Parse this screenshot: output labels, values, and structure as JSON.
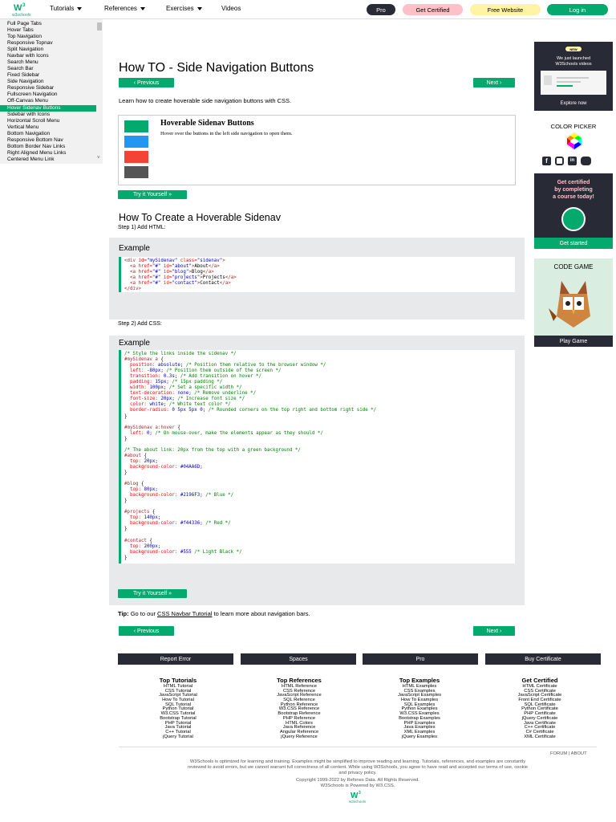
{
  "topnav": {
    "logo_text": "w3schools",
    "tutorials": "Tutorials",
    "references": "References",
    "exercises": "Exercises",
    "videos": "Videos",
    "pro": "Pro",
    "get_certified": "Get Certified",
    "free_website": "Free Website",
    "login": "Log in"
  },
  "sidebar": {
    "items": [
      "Full Page Tabs",
      "Hover Tabs",
      "Top Navigation",
      "Responsive Topnav",
      "Split Navigation",
      "Navbar with Icons",
      "Search Menu",
      "Search Bar",
      "Fixed Sidebar",
      "Side Navigation",
      "Responsive Sidebar",
      "Fullscreen Navigation",
      "Off-Canvas Menu",
      "Hover Sidenav Buttons",
      "Sidebar with Icons",
      "Horizontal Scroll Menu",
      "Vertical Menu",
      "Bottom Navigation",
      "Responsive Bottom Nav",
      "Bottom Border Nav Links",
      "Right Aligned Menu Links",
      "Centered Menu Link"
    ],
    "active_index": 13
  },
  "main": {
    "title": "How TO - Side Navigation Buttons",
    "previous": "Previous",
    "next": "Next",
    "intro": "Learn how to create hoverable side navigation buttons with CSS.",
    "demo_title": "Hoverable Sidenav Buttons",
    "demo_text": "Hover over the buttons in the left side navigation to open them.",
    "demo_colors": [
      "#04AA6D",
      "#2196F3",
      "#f44336",
      "#555555"
    ],
    "try_it": "Try it Yourself »",
    "h2": "How To Create a Hoverable Sidenav",
    "step1": "Step 1) Add HTML:",
    "step2": "Step 2) Add CSS:",
    "example_label": "Example",
    "tip_bold": "Tip:",
    "tip_before": " Go to our ",
    "tip_link": "CSS Navbar Tutorial",
    "tip_after": " to learn more about navigation bars."
  },
  "rightbar": {
    "ad1_badge": "NEW",
    "ad1_line1": "We just launched",
    "ad1_line2": "W3Schools videos",
    "ad1_cta": "Explore now",
    "color_picker": "COLOR PICKER",
    "ad2_line1": "Get certified",
    "ad2_line2": "by completing",
    "ad2_line3": "a course today!",
    "ad2_cta": "Get started",
    "code_game": "CODE GAME",
    "play_game": "Play Game"
  },
  "footer": {
    "buttons": [
      "Report Error",
      "Spaces",
      "Pro",
      "Buy Certificate"
    ],
    "columns": [
      {
        "title": "Top Tutorials",
        "items": [
          "HTML Tutorial",
          "CSS Tutorial",
          "JavaScript Tutorial",
          "How To Tutorial",
          "SQL Tutorial",
          "Python Tutorial",
          "W3.CSS Tutorial",
          "Bootstrap Tutorial",
          "PHP Tutorial",
          "Java Tutorial",
          "C++ Tutorial",
          "jQuery Tutorial"
        ]
      },
      {
        "title": "Top References",
        "items": [
          "HTML Reference",
          "CSS Reference",
          "JavaScript Reference",
          "SQL Reference",
          "Python Reference",
          "W3.CSS Reference",
          "Bootstrap Reference",
          "PHP Reference",
          "HTML Colors",
          "Java Reference",
          "Angular Reference",
          "jQuery Reference"
        ]
      },
      {
        "title": "Top Examples",
        "items": [
          "HTML Examples",
          "CSS Examples",
          "JavaScript Examples",
          "How To Examples",
          "SQL Examples",
          "Python Examples",
          "W3.CSS Examples",
          "Bootstrap Examples",
          "PHP Examples",
          "Java Examples",
          "XML Examples",
          "jQuery Examples"
        ]
      },
      {
        "title": "Get Certified",
        "items": [
          "HTML Certificate",
          "CSS Certificate",
          "JavaScript Certificate",
          "Front End Certificate",
          "SQL Certificate",
          "Python Certificate",
          "PHP Certificate",
          "jQuery Certificate",
          "Java Certificate",
          "C++ Certificate",
          "C# Certificate",
          "XML Certificate"
        ]
      }
    ],
    "forum_about": "FORUM | ABOUT",
    "disclaimer1": "W3Schools is optimized for learning and training. Examples might be simplified to improve reading and learning. Tutorials, references, and examples are constantly",
    "disclaimer2": "reviewed to avoid errors, but we cannot warrant full correctness of all content. While using W3Schools, you agree to have read and accepted our terms of use, cookie",
    "disclaimer3": "and privacy policy.",
    "copyright": "Copyright 1999-2022 by Refsnes Data. All Rights Reserved.",
    "powered": "W3Schools is Powered by W3.CSS."
  },
  "colors": {
    "green": "#04AA6D",
    "dark": "#282A35",
    "pink": "#ffc0c7",
    "yellow": "#fff4a3"
  }
}
